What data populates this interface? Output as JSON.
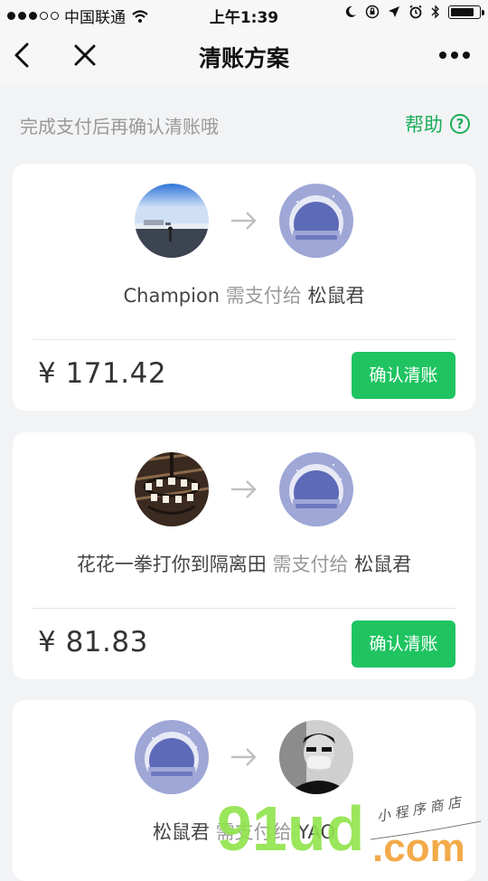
{
  "statusbar": {
    "carrier": "中国联通",
    "time": "上午1:39",
    "signal_bars": 3,
    "signal_total": 5,
    "battery_level": 0.85
  },
  "navbar": {
    "title": "清账方案",
    "back_icon": "chevron-left-icon",
    "close_icon": "close-icon",
    "more_icon": "more-icon"
  },
  "hint": {
    "text": "完成支付后再确认清账哦",
    "help_label": "帮助",
    "help_icon_glyph": "?"
  },
  "settlements": [
    {
      "payer": "Champion",
      "verb": "需支付给",
      "payee": "松鼠君",
      "amount": "¥ 171.42",
      "button": "确认清账"
    },
    {
      "payer": "花花一拳打你到隔离田",
      "verb": "需支付给",
      "payee": "松鼠君",
      "amount": "¥ 81.83",
      "button": "确认清账"
    },
    {
      "payer": "松鼠君",
      "verb": "需支付给",
      "payee": "YAO"
    }
  ],
  "watermark": {
    "brand": "91ud",
    "suffix": ".com",
    "tagline": "小 程 序 商 店"
  },
  "colors": {
    "accent": "#1aad5a",
    "button": "#1fc461",
    "background": "#f2f3f5"
  }
}
